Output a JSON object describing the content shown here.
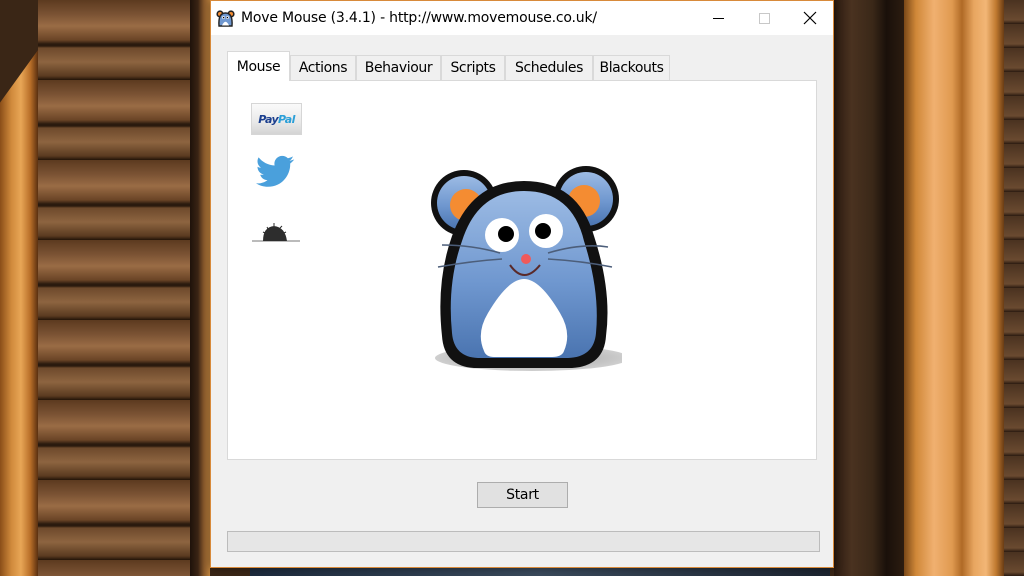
{
  "window": {
    "title": "Move Mouse (3.4.1) - http://www.movemouse.co.uk/",
    "controls": {
      "minimize": "minimize",
      "maximize": "maximize",
      "close": "close"
    },
    "accent_border_color": "#d88a3a"
  },
  "tabs": [
    {
      "label": "Mouse",
      "active": true
    },
    {
      "label": "Actions",
      "active": false
    },
    {
      "label": "Behaviour",
      "active": false
    },
    {
      "label": "Scripts",
      "active": false
    },
    {
      "label": "Schedules",
      "active": false
    },
    {
      "label": "Blackouts",
      "active": false
    }
  ],
  "mouse_tab": {
    "links": [
      {
        "name": "paypal",
        "icon": "paypal-icon",
        "text_part1": "Pay",
        "text_part2": "Pal"
      },
      {
        "name": "twitter",
        "icon": "twitter-icon"
      },
      {
        "name": "mole",
        "icon": "mole-hill-icon"
      }
    ],
    "mascot": "move-mouse-mascot",
    "colors": {
      "mascot_body": "#6f97cf",
      "mascot_ears": "#f48c32",
      "mascot_nose": "#f05a5a",
      "twitter_blue": "#4aa0dc"
    }
  },
  "start_button": {
    "label": "Start"
  },
  "progress": {
    "value_percent": 0
  }
}
